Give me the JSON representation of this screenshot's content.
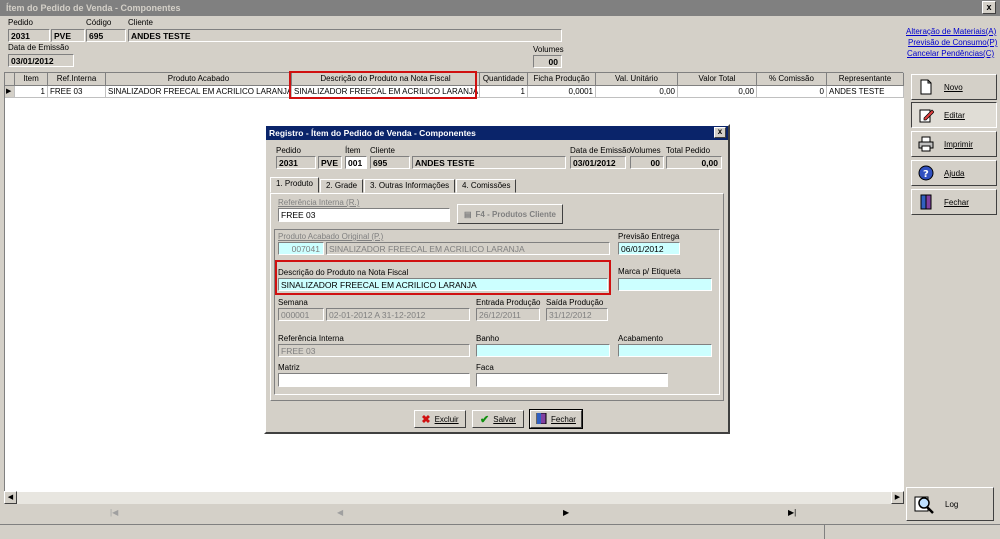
{
  "window": {
    "title": "Ítem do Pedido de Venda - Componentes",
    "close": "x"
  },
  "header": {
    "pedido_label": "Pedido",
    "pedido": "2031",
    "tipo": "PVE",
    "codigo_label": "Código",
    "codigo": "695",
    "cliente_label": "Cliente",
    "cliente": "ANDES TESTE",
    "emissao_label": "Data de Emissão",
    "emissao": "03/01/2012",
    "volumes_label": "Volumes",
    "volumes": "00"
  },
  "grid": {
    "headers": [
      "Item",
      "Ref.Interna",
      "Produto Acabado",
      "Descrição do Produto na Nota Fiscal",
      "Quantidade",
      "Ficha Produção",
      "Val. Unitário",
      "Valor Total",
      "% Comissão",
      "Representante"
    ],
    "row": [
      "1",
      "FREE 03",
      "SINALIZADOR FREECAL EM ACRILICO LARANJA",
      "SINALIZADOR FREECAL EM ACRILICO LARANJA",
      "1",
      "0,0001",
      "0,00",
      "0,00",
      "0",
      "ANDES TESTE"
    ],
    "row_marker": "▶"
  },
  "links": [
    "Alteração de Materiais(A)",
    "Previsão de Consumo(P)",
    "Cancelar Pendências(C)"
  ],
  "sidebar": {
    "novo": "Novo",
    "editar": "Editar",
    "imprimir": "Imprimir",
    "ajuda": "Ajuda",
    "fechar": "Fechar",
    "log": "Log"
  },
  "nav": {
    "first": "|◀",
    "prev": "◀",
    "next": "▶",
    "last": "▶|"
  },
  "dialog": {
    "title": "Registro - Ítem do Pedido de Venda - Componentes",
    "close": "x",
    "pedido_label": "Pedido",
    "pedido": "2031",
    "tipo": "PVE",
    "item_label": "Ítem",
    "item": "001",
    "cliente_label": "Cliente",
    "cliente_cod": "695",
    "cliente": "ANDES TESTE",
    "emissao_label": "Data de Emissão",
    "emissao": "03/01/2012",
    "volumes_label": "Volumes",
    "volumes": "00",
    "total_label": "Total Pedido",
    "total": "0,00",
    "tabs": [
      "1. Produto",
      "2. Grade",
      "3. Outras Informações",
      "4. Comissões"
    ],
    "ref_label": "Referência Interna (R.)",
    "ref": "FREE 03",
    "f4_button": "F4 - Produtos Cliente",
    "acabado_label": "Produto Acabado Original (P.)",
    "acabado_cod": "007041",
    "acabado": "SINALIZADOR FREECAL EM ACRILICO LARANJA",
    "previsao_label": "Previsão Entrega",
    "previsao": "06/01/2012",
    "descricao_label": "Descrição do Produto na Nota Fiscal",
    "descricao": "SINALIZADOR FREECAL EM ACRILICO LARANJA",
    "marca_label": "Marca p/ Etiqueta",
    "marca": "",
    "semana_label": "Semana",
    "semana": "000001",
    "semana_periodo": "02-01-2012 A 31-12-2012",
    "entrada_label": "Entrada Produção",
    "entrada": "26/12/2011",
    "saida_label": "Saída Produção",
    "saida": "31/12/2012",
    "refint_label": "Referência Interna",
    "refint": "FREE 03",
    "banho_label": "Banho",
    "banho": "",
    "acabamento_label": "Acabamento",
    "acabamento": "",
    "matriz_label": "Matriz",
    "matriz": "",
    "faca_label": "Faca",
    "faca": "",
    "excluir": "Excluir",
    "salvar": "Salvar",
    "fechar": "Fechar"
  }
}
